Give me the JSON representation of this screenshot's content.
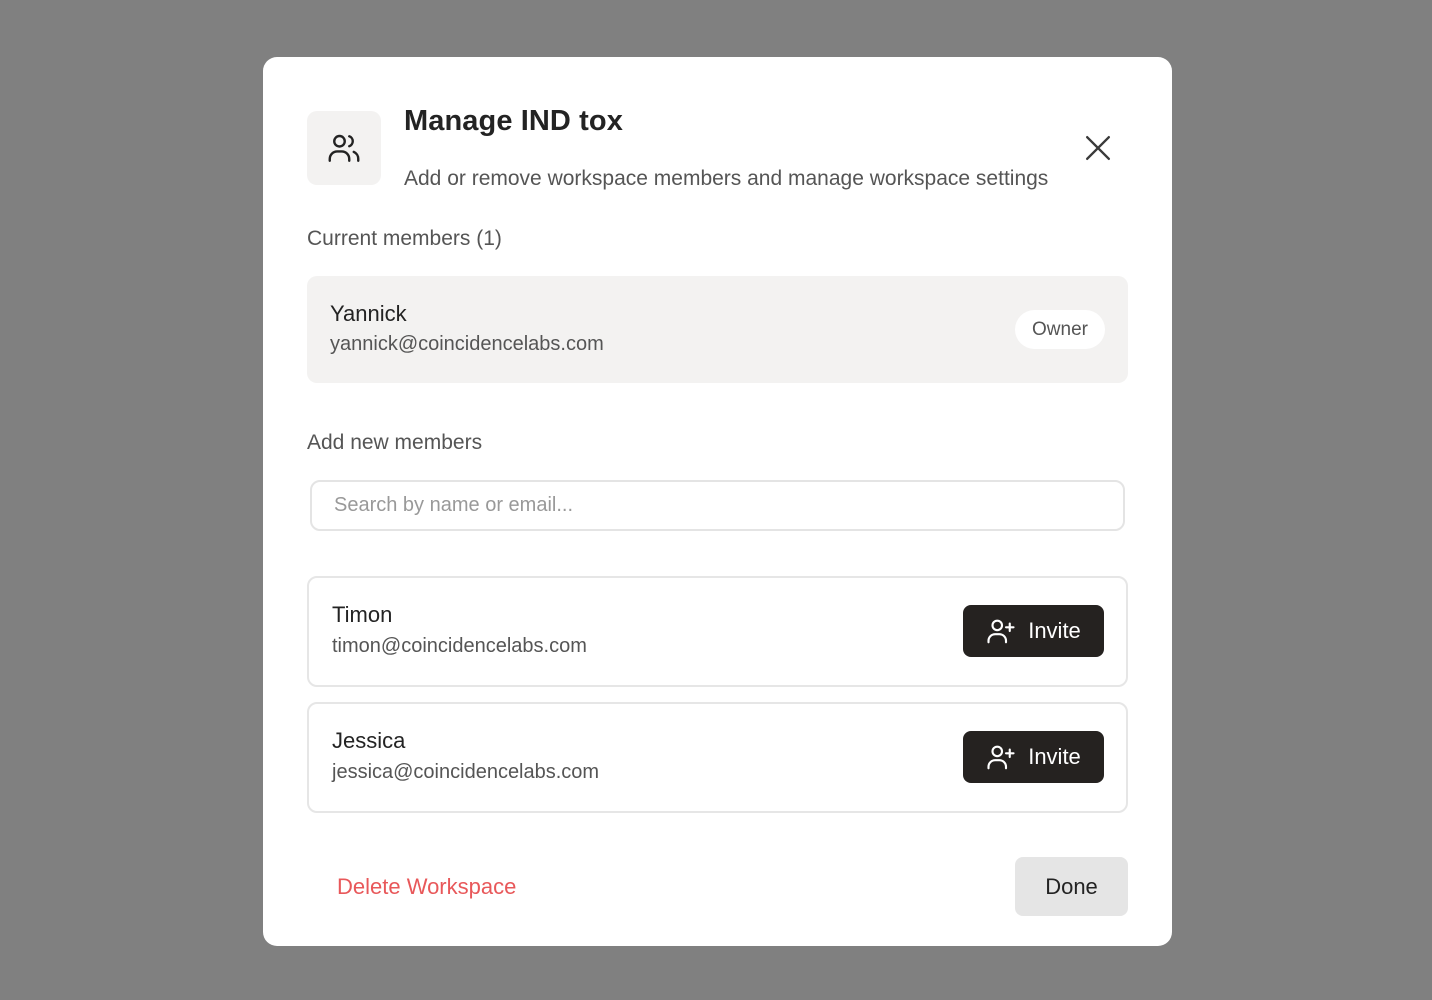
{
  "dialog": {
    "title": "Manage IND tox",
    "subtitle": "Add or remove workspace members and manage workspace settings",
    "header_icon": "users-icon",
    "close_icon": "close-icon"
  },
  "current_members": {
    "label": "Current members (1)",
    "members": [
      {
        "name": "Yannick",
        "email": "yannick@coincidencelabs.com",
        "role": "Owner"
      }
    ]
  },
  "add_members": {
    "label": "Add new members",
    "search": {
      "value": "",
      "placeholder": "Search by name or email..."
    },
    "candidates": [
      {
        "name": "Timon",
        "email": "timon@coincidencelabs.com",
        "action_label": "Invite",
        "action_icon": "user-plus-icon"
      },
      {
        "name": "Jessica",
        "email": "jessica@coincidencelabs.com",
        "action_label": "Invite",
        "action_icon": "user-plus-icon"
      }
    ]
  },
  "footer": {
    "delete_label": "Delete Workspace",
    "done_label": "Done"
  },
  "colors": {
    "overlay": "#808080",
    "danger": "#e8585a",
    "primary_button": "#252220",
    "card_background": "#f3f2f1"
  }
}
